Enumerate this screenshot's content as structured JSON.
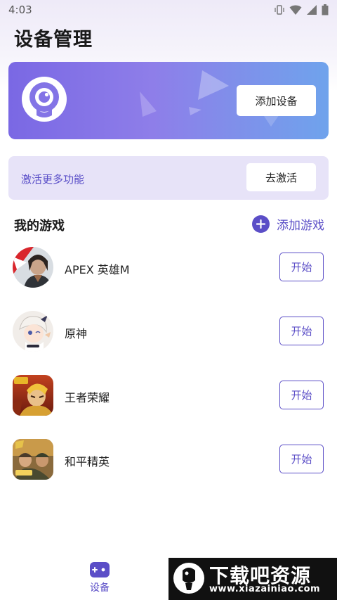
{
  "status_bar": {
    "time": "4:03"
  },
  "page": {
    "title": "设备管理"
  },
  "device_card": {
    "add_device_label": "添加设备"
  },
  "activate_card": {
    "text": "激活更多功能",
    "button_label": "去激活"
  },
  "games_section": {
    "title": "我的游戏",
    "add_game_label": "添加游戏",
    "items": [
      {
        "name": "APEX 英雄M",
        "start_label": "开始"
      },
      {
        "name": "原神",
        "start_label": "开始"
      },
      {
        "name": "王者荣耀",
        "start_label": "开始"
      },
      {
        "name": "和平精英",
        "start_label": "开始"
      }
    ]
  },
  "bottom_nav": {
    "items": [
      {
        "label": "设备",
        "icon": "gamepad-icon",
        "active": true
      }
    ]
  },
  "watermark": {
    "title": "下载吧资源",
    "url": "www.xiazainiao.com"
  },
  "colors": {
    "accent": "#5b4ec7",
    "card_gradient_start": "#7a68e4",
    "card_gradient_end": "#6fa3ec",
    "activate_bg": "#e7e3f8"
  }
}
